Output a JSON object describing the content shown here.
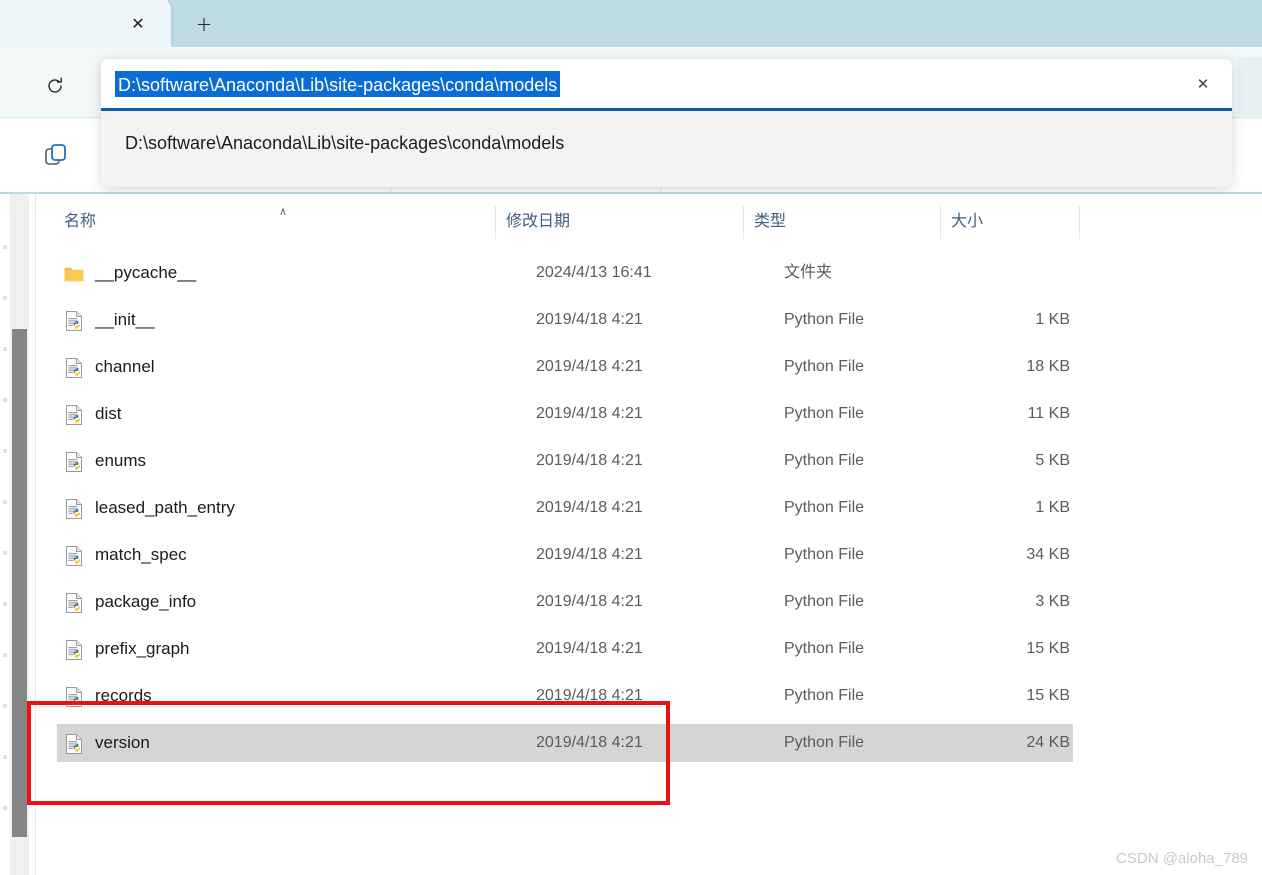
{
  "tabbar": {
    "close_label": "✕",
    "new_tab_label": "+"
  },
  "toolbar": {
    "refresh_icon": "refresh-icon",
    "copy_icon": "copy-icon"
  },
  "address_bar": {
    "value": "D:\\software\\Anaconda\\Lib\\site-packages\\conda\\models",
    "clear_label": "✕",
    "suggestion": "D:\\software\\Anaconda\\Lib\\site-packages\\conda\\models"
  },
  "columns": {
    "name": "名称",
    "date": "修改日期",
    "type": "类型",
    "size": "大小",
    "sort_caret": "∧"
  },
  "files": [
    {
      "name": "__pycache__",
      "date": "2024/4/13 16:41",
      "type": "文件夹",
      "size": "",
      "icon": "folder-icon",
      "selected": false
    },
    {
      "name": "__init__",
      "date": "2019/4/18 4:21",
      "type": "Python File",
      "size": "1 KB",
      "icon": "python-file-icon",
      "selected": false
    },
    {
      "name": "channel",
      "date": "2019/4/18 4:21",
      "type": "Python File",
      "size": "18 KB",
      "icon": "python-file-icon",
      "selected": false
    },
    {
      "name": "dist",
      "date": "2019/4/18 4:21",
      "type": "Python File",
      "size": "11 KB",
      "icon": "python-file-icon",
      "selected": false
    },
    {
      "name": "enums",
      "date": "2019/4/18 4:21",
      "type": "Python File",
      "size": "5 KB",
      "icon": "python-file-icon",
      "selected": false
    },
    {
      "name": "leased_path_entry",
      "date": "2019/4/18 4:21",
      "type": "Python File",
      "size": "1 KB",
      "icon": "python-file-icon",
      "selected": false
    },
    {
      "name": "match_spec",
      "date": "2019/4/18 4:21",
      "type": "Python File",
      "size": "34 KB",
      "icon": "python-file-icon",
      "selected": false
    },
    {
      "name": "package_info",
      "date": "2019/4/18 4:21",
      "type": "Python File",
      "size": "3 KB",
      "icon": "python-file-icon",
      "selected": false
    },
    {
      "name": "prefix_graph",
      "date": "2019/4/18 4:21",
      "type": "Python File",
      "size": "15 KB",
      "icon": "python-file-icon",
      "selected": false
    },
    {
      "name": "records",
      "date": "2019/4/18 4:21",
      "type": "Python File",
      "size": "15 KB",
      "icon": "python-file-icon",
      "selected": false
    },
    {
      "name": "version",
      "date": "2019/4/18 4:21",
      "type": "Python File",
      "size": "24 KB",
      "icon": "python-file-icon",
      "selected": true
    }
  ],
  "annotation": {
    "color": "#ee1111"
  },
  "watermark": {
    "text": "CSDN @aloha_789"
  },
  "colors": {
    "tabstrip": "#bedbe4",
    "toolbar": "#f3f8f9",
    "address_selection": "#0a6cd4",
    "address_underline": "#0d5ba9",
    "row_selected": "#d5d5d5",
    "header_text": "#42607e"
  }
}
